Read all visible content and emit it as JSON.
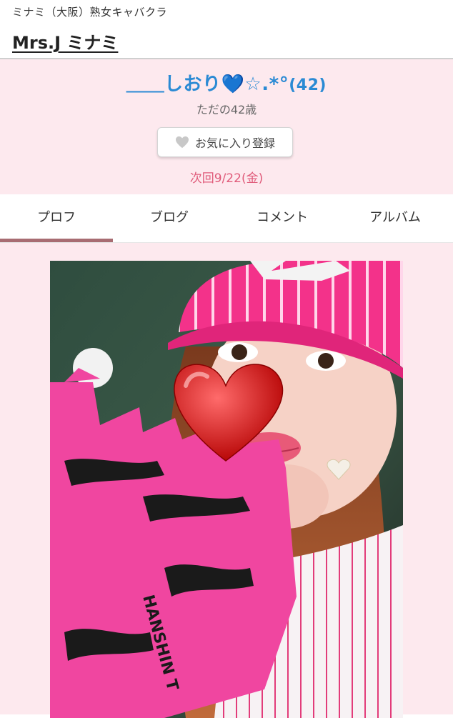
{
  "header": {
    "area": "ミナミ（大阪）熟女キャバクラ",
    "shop_name": "Mrs.J ミナミ"
  },
  "profile": {
    "name": "＿＿しおり💙☆.*°",
    "age_num": "(42)",
    "catch": "ただの42歳",
    "favorite_label": "お気に入り登録",
    "favorite_icon": "heart-icon",
    "next_shift": "次回9/22(金)"
  },
  "tabs": [
    "プロフ",
    "ブログ",
    "コメント",
    "アルバム"
  ],
  "active_tab": 0,
  "photo": {
    "glove_text": "HANSHIN T"
  },
  "colors": {
    "name": "#2a8ad4",
    "next": "#e05b7a",
    "profile_bg": "#fde9ee",
    "tab_indicator": "#a86c72"
  }
}
